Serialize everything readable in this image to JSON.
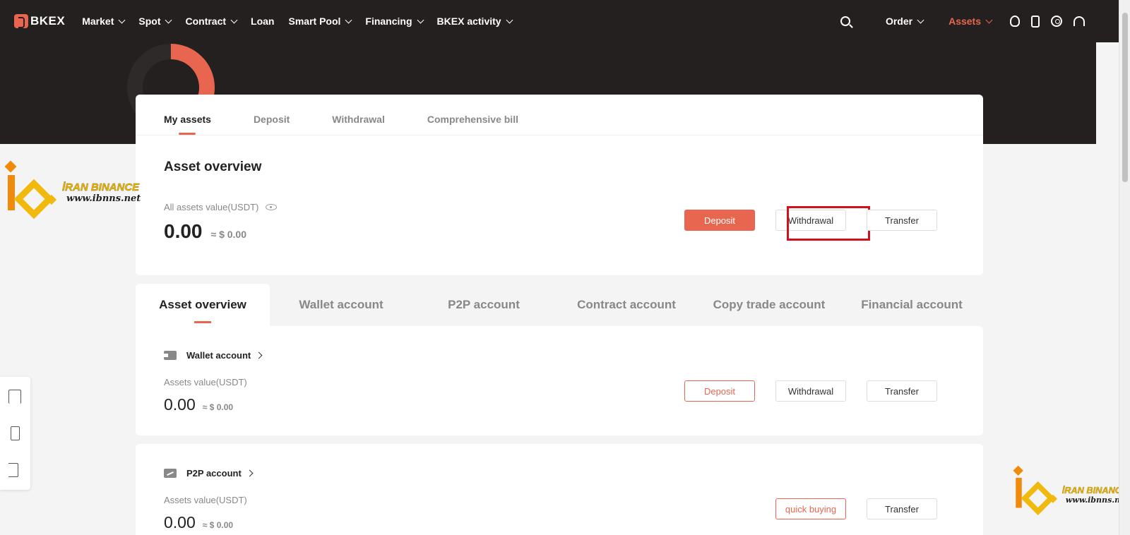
{
  "nav": {
    "logo": "BKEX",
    "items": [
      {
        "label": "Market",
        "dropdown": true
      },
      {
        "label": "Spot",
        "dropdown": true
      },
      {
        "label": "Contract",
        "dropdown": true
      },
      {
        "label": "Loan",
        "dropdown": false
      },
      {
        "label": "Smart Pool",
        "dropdown": true
      },
      {
        "label": "Financing",
        "dropdown": true
      },
      {
        "label": "BKEX activity",
        "dropdown": true
      }
    ],
    "order": "Order",
    "assets": "Assets",
    "accent": "#e8664f"
  },
  "top_tabs": [
    "My assets",
    "Deposit",
    "Withdrawal",
    "Comprehensive bill"
  ],
  "overview": {
    "title": "Asset overview",
    "label": "All assets value(USDT)",
    "value": "0.00",
    "approx": "≈ $ 0.00",
    "buttons": {
      "deposit": "Deposit",
      "withdrawal": "Withdrawal",
      "transfer": "Transfer"
    }
  },
  "sub_tabs": [
    "Asset overview",
    "Wallet account",
    "P2P account",
    "Contract account",
    "Copy trade account",
    "Financial account"
  ],
  "wallet": {
    "title": "Wallet account",
    "label": "Assets value(USDT)",
    "value": "0.00",
    "approx": "≈ $ 0.00",
    "buttons": {
      "deposit": "Deposit",
      "withdrawal": "Withdrawal",
      "transfer": "Transfer"
    }
  },
  "p2p": {
    "title": "P2P account",
    "label": "Assets value(USDT)",
    "value": "0.00",
    "approx": "≈ $ 0.00",
    "buttons": {
      "quick": "quick buying",
      "transfer": "Transfer"
    }
  },
  "watermark": {
    "name": "İRAN BINANCE",
    "url": "www.ibnns.net"
  }
}
